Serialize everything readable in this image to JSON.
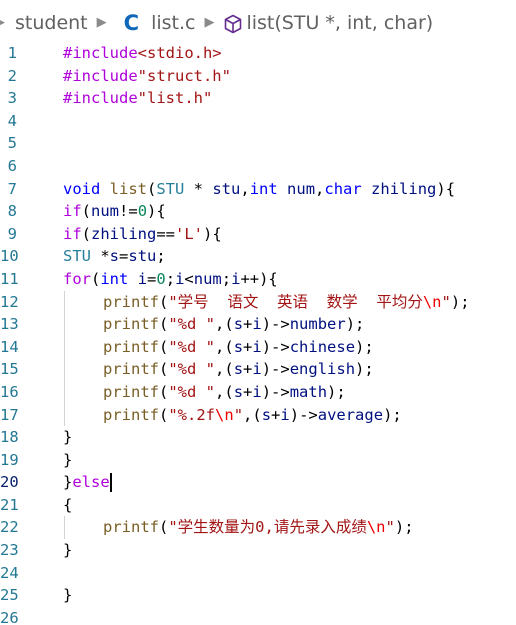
{
  "breadcrumb": {
    "folder": "student",
    "file": "list.c",
    "symbol": "list(STU *, int, char)",
    "file_icon": "c-language-icon",
    "symbol_icon": "function-cube-icon"
  },
  "cursor_line": 20,
  "lines": [
    {
      "n": "1",
      "tokens": [
        {
          "t": "#include",
          "c": "kw-pp"
        },
        {
          "t": "<stdio.h>",
          "c": "str"
        }
      ]
    },
    {
      "n": "2",
      "tokens": [
        {
          "t": "#include",
          "c": "kw-pp"
        },
        {
          "t": "\"struct.h\"",
          "c": "str"
        }
      ]
    },
    {
      "n": "3",
      "tokens": [
        {
          "t": "#include",
          "c": "kw-pp"
        },
        {
          "t": "\"list.h\"",
          "c": "str"
        }
      ]
    },
    {
      "n": "4",
      "tokens": []
    },
    {
      "n": "5",
      "tokens": []
    },
    {
      "n": "6",
      "tokens": []
    },
    {
      "n": "7",
      "tokens": [
        {
          "t": "void",
          "c": "kw-type"
        },
        {
          "t": " ",
          "c": "plain"
        },
        {
          "t": "list",
          "c": "fn"
        },
        {
          "t": "(",
          "c": "plain"
        },
        {
          "t": "STU",
          "c": "type"
        },
        {
          "t": " * ",
          "c": "plain"
        },
        {
          "t": "stu",
          "c": "var"
        },
        {
          "t": ",",
          "c": "plain"
        },
        {
          "t": "int",
          "c": "kw-type"
        },
        {
          "t": " ",
          "c": "plain"
        },
        {
          "t": "num",
          "c": "var"
        },
        {
          "t": ",",
          "c": "plain"
        },
        {
          "t": "char",
          "c": "kw-type"
        },
        {
          "t": " ",
          "c": "plain"
        },
        {
          "t": "zhiling",
          "c": "var"
        },
        {
          "t": "){",
          "c": "plain"
        }
      ]
    },
    {
      "n": "8",
      "tokens": [
        {
          "t": "if",
          "c": "kw-ctrl"
        },
        {
          "t": "(",
          "c": "plain"
        },
        {
          "t": "num",
          "c": "var"
        },
        {
          "t": "!=",
          "c": "plain"
        },
        {
          "t": "0",
          "c": "num"
        },
        {
          "t": "){",
          "c": "plain"
        }
      ]
    },
    {
      "n": "9",
      "tokens": [
        {
          "t": "if",
          "c": "kw-ctrl"
        },
        {
          "t": "(",
          "c": "plain"
        },
        {
          "t": "zhiling",
          "c": "var"
        },
        {
          "t": "==",
          "c": "plain"
        },
        {
          "t": "'L'",
          "c": "str"
        },
        {
          "t": "){",
          "c": "plain"
        }
      ]
    },
    {
      "n": "10",
      "tokens": [
        {
          "t": "STU",
          "c": "type"
        },
        {
          "t": " *",
          "c": "plain"
        },
        {
          "t": "s",
          "c": "var"
        },
        {
          "t": "=",
          "c": "plain"
        },
        {
          "t": "stu",
          "c": "var"
        },
        {
          "t": ";",
          "c": "plain"
        }
      ]
    },
    {
      "n": "11",
      "tokens": [
        {
          "t": "for",
          "c": "kw-ctrl"
        },
        {
          "t": "(",
          "c": "plain"
        },
        {
          "t": "int",
          "c": "kw-type"
        },
        {
          "t": " ",
          "c": "plain"
        },
        {
          "t": "i",
          "c": "var"
        },
        {
          "t": "=",
          "c": "plain"
        },
        {
          "t": "0",
          "c": "num"
        },
        {
          "t": ";",
          "c": "plain"
        },
        {
          "t": "i",
          "c": "var"
        },
        {
          "t": "<",
          "c": "plain"
        },
        {
          "t": "num",
          "c": "var"
        },
        {
          "t": ";",
          "c": "plain"
        },
        {
          "t": "i",
          "c": "var"
        },
        {
          "t": "++){",
          "c": "plain"
        }
      ]
    },
    {
      "n": "12",
      "indent": true,
      "tokens": [
        {
          "t": "printf",
          "c": "fn"
        },
        {
          "t": "(",
          "c": "plain"
        },
        {
          "t": "\"学号  语文  英语  数学  平均分",
          "c": "str"
        },
        {
          "t": "\\n",
          "c": "esc"
        },
        {
          "t": "\"",
          "c": "str"
        },
        {
          "t": ");",
          "c": "plain"
        }
      ]
    },
    {
      "n": "13",
      "indent": true,
      "tokens": [
        {
          "t": "printf",
          "c": "fn"
        },
        {
          "t": "(",
          "c": "plain"
        },
        {
          "t": "\"%d \"",
          "c": "str"
        },
        {
          "t": ",(",
          "c": "plain"
        },
        {
          "t": "s",
          "c": "var"
        },
        {
          "t": "+",
          "c": "plain"
        },
        {
          "t": "i",
          "c": "var"
        },
        {
          "t": ")->",
          "c": "plain"
        },
        {
          "t": "number",
          "c": "var"
        },
        {
          "t": ");",
          "c": "plain"
        }
      ]
    },
    {
      "n": "14",
      "indent": true,
      "tokens": [
        {
          "t": "printf",
          "c": "fn"
        },
        {
          "t": "(",
          "c": "plain"
        },
        {
          "t": "\"%d \"",
          "c": "str"
        },
        {
          "t": ",(",
          "c": "plain"
        },
        {
          "t": "s",
          "c": "var"
        },
        {
          "t": "+",
          "c": "plain"
        },
        {
          "t": "i",
          "c": "var"
        },
        {
          "t": ")->",
          "c": "plain"
        },
        {
          "t": "chinese",
          "c": "var"
        },
        {
          "t": ");",
          "c": "plain"
        }
      ]
    },
    {
      "n": "15",
      "indent": true,
      "tokens": [
        {
          "t": "printf",
          "c": "fn"
        },
        {
          "t": "(",
          "c": "plain"
        },
        {
          "t": "\"%d \"",
          "c": "str"
        },
        {
          "t": ",(",
          "c": "plain"
        },
        {
          "t": "s",
          "c": "var"
        },
        {
          "t": "+",
          "c": "plain"
        },
        {
          "t": "i",
          "c": "var"
        },
        {
          "t": ")->",
          "c": "plain"
        },
        {
          "t": "english",
          "c": "var"
        },
        {
          "t": ");",
          "c": "plain"
        }
      ]
    },
    {
      "n": "16",
      "indent": true,
      "tokens": [
        {
          "t": "printf",
          "c": "fn"
        },
        {
          "t": "(",
          "c": "plain"
        },
        {
          "t": "\"%d \"",
          "c": "str"
        },
        {
          "t": ",(",
          "c": "plain"
        },
        {
          "t": "s",
          "c": "var"
        },
        {
          "t": "+",
          "c": "plain"
        },
        {
          "t": "i",
          "c": "var"
        },
        {
          "t": ")->",
          "c": "plain"
        },
        {
          "t": "math",
          "c": "var"
        },
        {
          "t": ");",
          "c": "plain"
        }
      ]
    },
    {
      "n": "17",
      "indent": true,
      "tokens": [
        {
          "t": "printf",
          "c": "fn"
        },
        {
          "t": "(",
          "c": "plain"
        },
        {
          "t": "\"%.2f",
          "c": "str"
        },
        {
          "t": "\\n",
          "c": "esc"
        },
        {
          "t": "\"",
          "c": "str"
        },
        {
          "t": ",(",
          "c": "plain"
        },
        {
          "t": "s",
          "c": "var"
        },
        {
          "t": "+",
          "c": "plain"
        },
        {
          "t": "i",
          "c": "var"
        },
        {
          "t": ")->",
          "c": "plain"
        },
        {
          "t": "average",
          "c": "var"
        },
        {
          "t": ");",
          "c": "plain"
        }
      ]
    },
    {
      "n": "18",
      "tokens": [
        {
          "t": "}",
          "c": "plain"
        }
      ]
    },
    {
      "n": "19",
      "tokens": [
        {
          "t": "}",
          "c": "plain"
        }
      ]
    },
    {
      "n": "20",
      "tokens": [
        {
          "t": "}",
          "c": "plain"
        },
        {
          "t": "else",
          "c": "kw-ctrl"
        }
      ]
    },
    {
      "n": "21",
      "tokens": [
        {
          "t": "{",
          "c": "plain"
        }
      ]
    },
    {
      "n": "22",
      "indent": true,
      "tokens": [
        {
          "t": "printf",
          "c": "fn"
        },
        {
          "t": "(",
          "c": "plain"
        },
        {
          "t": "\"学生数量为0,请先录入成绩",
          "c": "str"
        },
        {
          "t": "\\n",
          "c": "esc"
        },
        {
          "t": "\"",
          "c": "str"
        },
        {
          "t": ");",
          "c": "plain"
        }
      ]
    },
    {
      "n": "23",
      "tokens": [
        {
          "t": "}",
          "c": "plain"
        }
      ]
    },
    {
      "n": "24",
      "tokens": []
    },
    {
      "n": "25",
      "tokens": [
        {
          "t": "}",
          "c": "plain"
        }
      ]
    },
    {
      "n": "26",
      "tokens": []
    }
  ]
}
